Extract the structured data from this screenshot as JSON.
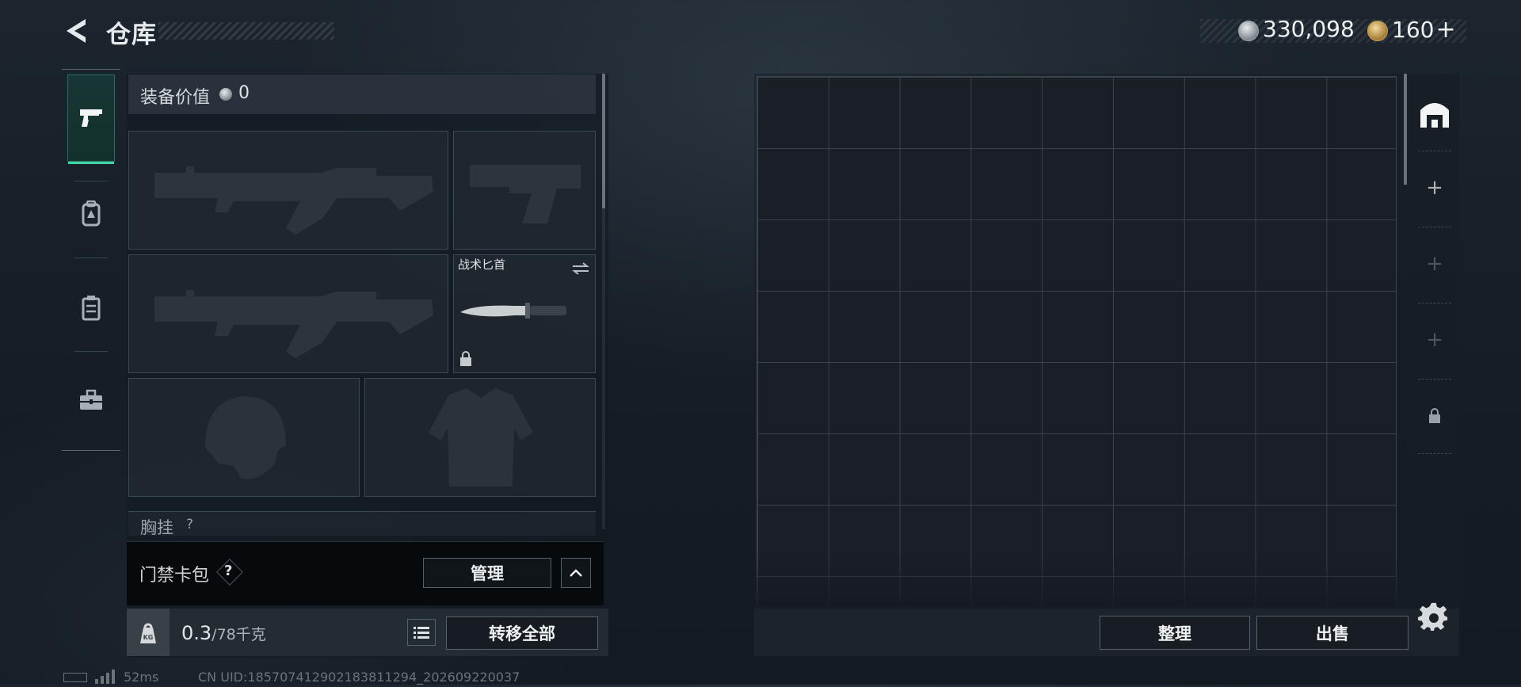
{
  "header": {
    "title": "仓库",
    "silver_amount": "330,098",
    "gold_amount": "160",
    "gold_plus": "+"
  },
  "left_tabs": [
    {
      "name": "weapons",
      "icon": "pistol-icon",
      "active": true
    },
    {
      "name": "backpack",
      "icon": "backpack-icon",
      "active": false
    },
    {
      "name": "vest",
      "icon": "vest-icon",
      "active": false
    },
    {
      "name": "toolbox",
      "icon": "toolbox-icon",
      "active": false
    }
  ],
  "loadout": {
    "value_label": "装备价值",
    "value_amount": "0",
    "knife_name": "战术匕首",
    "chest_label": "胸挂",
    "chest_help": "?"
  },
  "keycard": {
    "label": "门禁卡包",
    "help": "?",
    "manage_label": "管理"
  },
  "weight": {
    "current": "0.3",
    "max": "/78千克",
    "icon_text": "KG",
    "transfer_label": "转移全部"
  },
  "stash": {
    "sort_label": "整理",
    "sell_label": "出售"
  },
  "status": {
    "ping": "52ms",
    "uid": "CN UID:18570741290218381129​4_202609220037"
  },
  "colors": {
    "accent": "#3fd6a6",
    "background": "#161e26"
  }
}
